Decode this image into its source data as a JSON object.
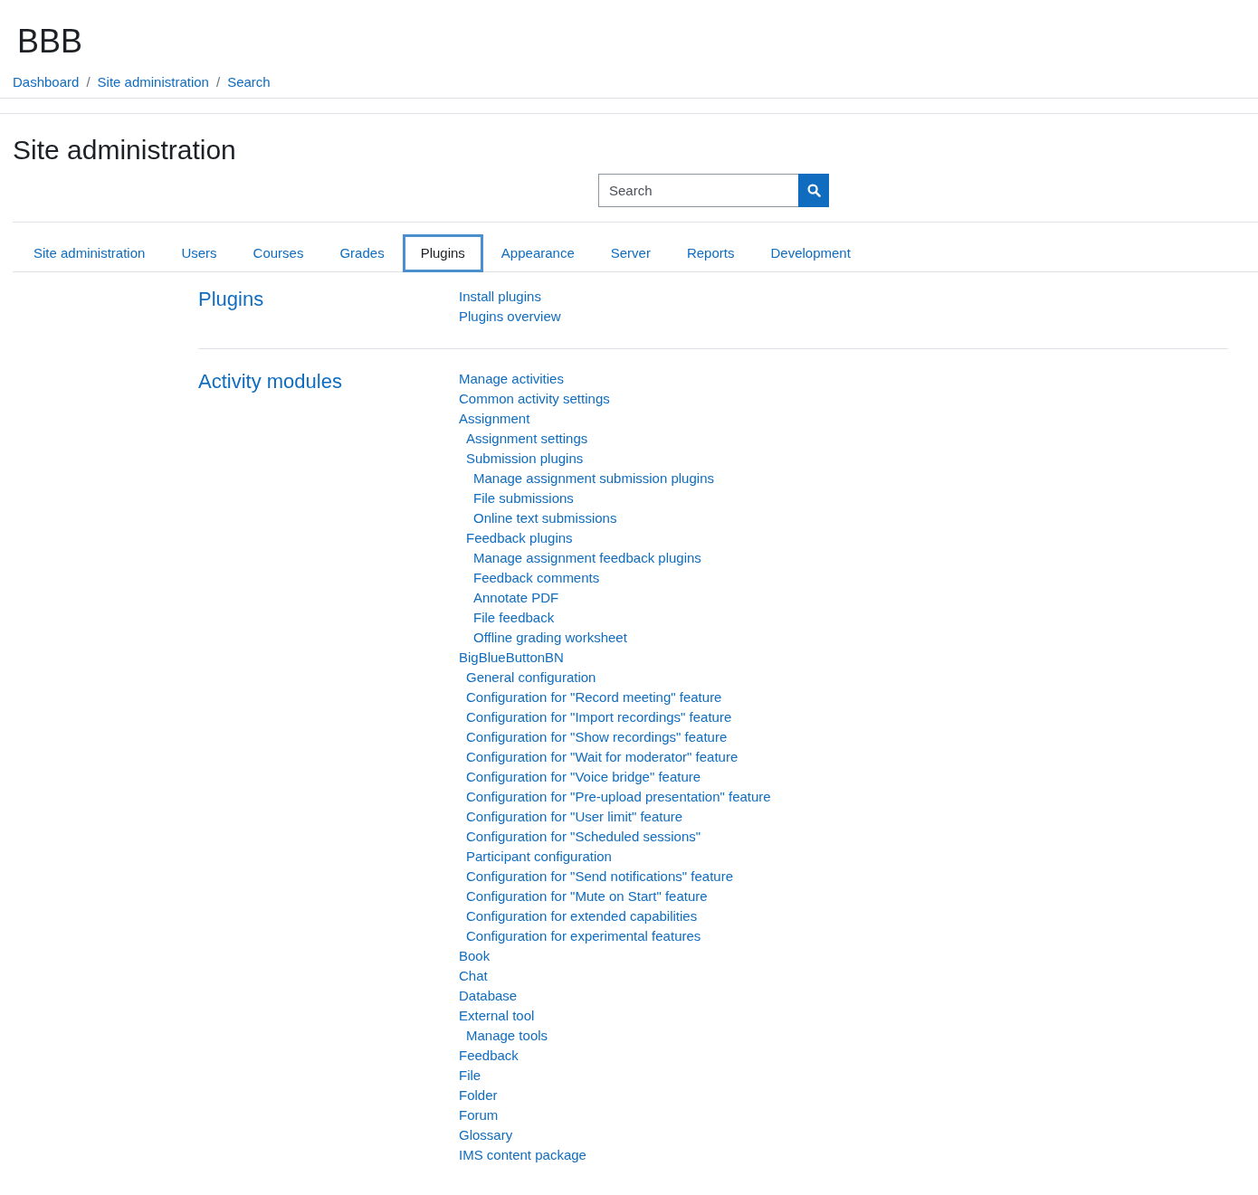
{
  "site_name": "BBB",
  "breadcrumb": [
    "Dashboard",
    "Site administration",
    "Search"
  ],
  "breadcrumb_separator": "/",
  "page_title": "Site administration",
  "search": {
    "placeholder": "Search"
  },
  "tabs": [
    {
      "label": "Site administration",
      "selected": false
    },
    {
      "label": "Users",
      "selected": false
    },
    {
      "label": "Courses",
      "selected": false
    },
    {
      "label": "Grades",
      "selected": false
    },
    {
      "label": "Plugins",
      "selected": true
    },
    {
      "label": "Appearance",
      "selected": false
    },
    {
      "label": "Server",
      "selected": false
    },
    {
      "label": "Reports",
      "selected": false
    },
    {
      "label": "Development",
      "selected": false
    }
  ],
  "sections": [
    {
      "title": "Plugins",
      "links": [
        {
          "label": "Install plugins"
        },
        {
          "label": "Plugins overview"
        }
      ]
    },
    {
      "title": "Activity modules",
      "links": [
        {
          "label": "Manage activities"
        },
        {
          "label": "Common activity settings"
        },
        {
          "label": "Assignment",
          "children": [
            {
              "label": "Assignment settings"
            },
            {
              "label": "Submission plugins",
              "children": [
                {
                  "label": "Manage assignment submission plugins"
                },
                {
                  "label": "File submissions"
                },
                {
                  "label": "Online text submissions"
                }
              ]
            },
            {
              "label": "Feedback plugins",
              "children": [
                {
                  "label": "Manage assignment feedback plugins"
                },
                {
                  "label": "Feedback comments"
                },
                {
                  "label": "Annotate PDF"
                },
                {
                  "label": "File feedback"
                },
                {
                  "label": "Offline grading worksheet"
                }
              ]
            }
          ]
        },
        {
          "label": "BigBlueButtonBN",
          "children": [
            {
              "label": "General configuration"
            },
            {
              "label": "Configuration for \"Record meeting\" feature"
            },
            {
              "label": "Configuration for \"Import recordings\" feature"
            },
            {
              "label": "Configuration for \"Show recordings\" feature"
            },
            {
              "label": "Configuration for \"Wait for moderator\" feature"
            },
            {
              "label": "Configuration for \"Voice bridge\" feature"
            },
            {
              "label": "Configuration for \"Pre-upload presentation\" feature"
            },
            {
              "label": "Configuration for \"User limit\" feature"
            },
            {
              "label": "Configuration for \"Scheduled sessions\""
            },
            {
              "label": "Participant configuration"
            },
            {
              "label": "Configuration for \"Send notifications\" feature"
            },
            {
              "label": "Configuration for \"Mute on Start\" feature"
            },
            {
              "label": "Configuration for extended capabilities"
            },
            {
              "label": "Configuration for experimental features"
            }
          ]
        },
        {
          "label": "Book"
        },
        {
          "label": "Chat"
        },
        {
          "label": "Database"
        },
        {
          "label": "External tool",
          "children": [
            {
              "label": "Manage tools"
            }
          ]
        },
        {
          "label": "Feedback"
        },
        {
          "label": "File"
        },
        {
          "label": "Folder"
        },
        {
          "label": "Forum"
        },
        {
          "label": "Glossary"
        },
        {
          "label": "IMS content package"
        }
      ]
    }
  ]
}
